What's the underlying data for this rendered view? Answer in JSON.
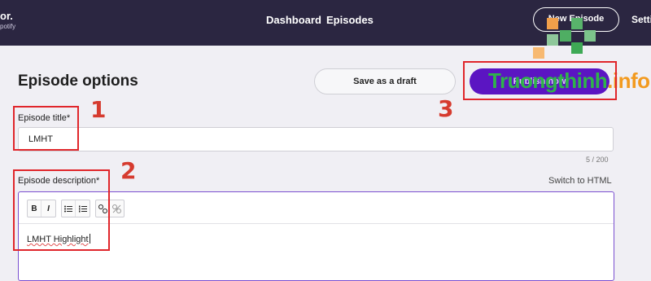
{
  "header": {
    "brand": "or.",
    "brand_sub": "potify",
    "nav": [
      "Dashboard",
      "Episodes"
    ],
    "new_episode": "New Episode",
    "settings": "Setti"
  },
  "page": {
    "title": "Episode options",
    "save_draft": "Save as a draft",
    "publish": "Publish now"
  },
  "form": {
    "title_label": "Episode title*",
    "title_value": "LMHT",
    "title_counter": "5 / 200",
    "desc_label": "Episode description*",
    "switch_html": "Switch to HTML",
    "toolbar": {
      "bold": "B",
      "italic": "I"
    },
    "desc_value": "LMHT Highlight"
  },
  "annotations": [
    "1",
    "2",
    "3"
  ],
  "watermark": {
    "name": "Truongthinh",
    "dot": ".",
    "suffix": "info"
  },
  "colors": {
    "header_bg": "#2b2641",
    "accent": "#5b15c2",
    "annotation": "#e0262b",
    "watermark_green": "#2fb34a",
    "watermark_orange": "#f29a1f"
  }
}
